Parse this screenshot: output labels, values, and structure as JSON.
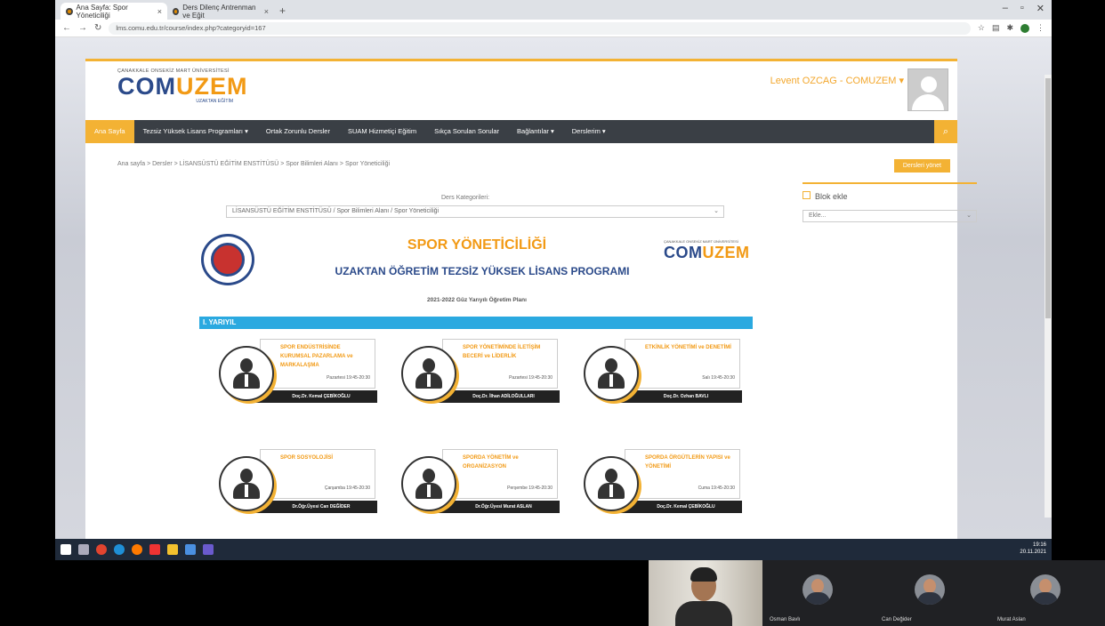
{
  "browser": {
    "tabs": [
      {
        "label": "Ana Sayfa: Spor Yöneticiliği"
      },
      {
        "label": "Ders Dilenç Antrenman ve Eğit"
      }
    ],
    "new_tab": "+",
    "url": "lms.comu.edu.tr/course/index.php?categoryid=167",
    "window_controls": [
      "–",
      "▫",
      "✕"
    ]
  },
  "site": {
    "university": "ÇANAKKALE ONSEKİZ MART ÜNİVERSİTESİ",
    "logo_a": "COM",
    "logo_b": "UZEM",
    "logo_sub": "UZAKTAN EĞİTİM",
    "user_name": "Levent OZCAG - COMUZEM",
    "nav": [
      "Ana Sayfa",
      "Tezsiz Yüksek Lisans Programları ▾",
      "Ortak Zorunlu Dersler",
      "SUAM Hizmetiçi Eğitim",
      "Sıkça Sorulan Sorular",
      "Bağlantılar ▾",
      "Derslerim ▾"
    ],
    "breadcrumb": "Ana sayfa > Dersler > LİSANSÜSTÜ EĞİTİM ENSTİTÜSÜ > Spor Bilimleri Alanı > Spor Yöneticiliği",
    "edit_button": "Dersleri yönet",
    "block_add": "Blok ekle",
    "block_select": "Ekle...",
    "category_label": "Ders Kategorileri:",
    "category_value": "LİSANSÜSTÜ EĞİTİM ENSTİTÜSÜ / Spor Bilimleri Alanı / Spor Yöneticiliği"
  },
  "program": {
    "title": "SPOR YÖNETİCİLİĞİ",
    "subtitle": "UZAKTAN ÖĞRETİM TEZSİZ YÜKSEK LİSANS PROGRAMI",
    "plan": "2021-2022 Güz Yarıyılı Öğretim Planı",
    "semester": "I. YARIYIL",
    "courses": [
      {
        "name": "SPOR ENDÜSTRİSİNDE KURUMSAL PAZARLAMA ve MARKALAŞMA",
        "time": "Pazartesi 19:45-20:30",
        "teacher": "Doç.Dr. Kemal ÇEBİKOĞLU"
      },
      {
        "name": "SPOR YÖNETİMİNDE İLETİŞİM BECERİ ve LİDERLİK",
        "time": "Pazartesi 19:45-20:30",
        "teacher": "Doç.Dr. İlhan ADİLOĞULLARI"
      },
      {
        "name": "ETKİNLİK YÖNETİMİ ve DENETİMİ",
        "time": "Salı 19:45-20:30",
        "teacher": "Doç.Dr. Ozhan BAVLI"
      },
      {
        "name": "SPOR SOSYOLOJİSİ",
        "time": "Çarşamba 19:45-20:30",
        "teacher": "Dr.Öğr.Üyesi Can DEĞİDER"
      },
      {
        "name": "SPORDA YÖNETİM ve ORGANİZASYON",
        "time": "Perşembe 19:45-20:30",
        "teacher": "Dr.Öğr.Üyesi Murat ASLAN"
      },
      {
        "name": "SPORDA ÖRGÜTLERİN YAPISI ve YÖNETİMİ",
        "time": "Cuma 19:45-20:30",
        "teacher": "Doç.Dr. Kemal ÇEBİKOĞLU"
      }
    ]
  },
  "taskbar": {
    "time": "19:16",
    "date": "20.11.2021"
  },
  "participants": [
    {
      "name": "Osman Bavlı"
    },
    {
      "name": "Can Değider"
    },
    {
      "name": "Murat Aslan"
    }
  ]
}
